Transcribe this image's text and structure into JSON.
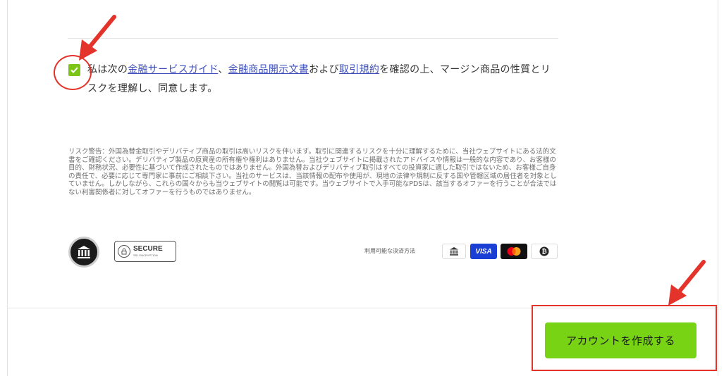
{
  "consent": {
    "checked": true,
    "text_before": "私は次の",
    "link1": "金融サービスガイド",
    "sep1": "、",
    "link2": "金融商品開示文書",
    "between": "および",
    "link3": "取引規約",
    "text_after": "を確認の上、マージン商品の性質とリスクを理解し、同意します。"
  },
  "risk_warning": "リスク警告：外国為替金取引やデリバティブ商品の取引は高いリスクを伴います。取引に関連するリスクを十分に理解するために、当社ウェブサイトにある法的文書をご確認ください。デリバティブ製品の原資産の所有権や権利はありません。当社ウェブサイトに掲載されたアドバイスや情報は一般的な内容であり、お客様の目的、財務状況、必要性に基づいて作成されたものではありません。外国為替およびデリバティブ取引はすべての投資家に適した取引ではないため、お客様ご自身の責任で、必要に応じて専門家に事前にご相談下さい。当社のサービスは、当該情報の配布や使用が、現地の法律や規制に反する国や管轄区域の居住者を対象としていません。しかしながら、これらの国々からも当ウェブサイトの閲覧は可能です。当ウェブサイトで入手可能なPDSは、該当するオファーを行うことが合法ではない利害関係者に対してオファーを行うものではありません。",
  "badges": {
    "secure_label": "SECURE",
    "secure_sub": "SSL ENCRYPTION"
  },
  "payment": {
    "label": "利用可能な決済方法",
    "visa_label": "VISA"
  },
  "cta": {
    "label": "アカウントを作成する"
  },
  "colors": {
    "accent_green": "#77d314",
    "checkbox_green": "#7cc417",
    "annotation_red": "#e4332a",
    "link_blue": "#3c4fb8"
  }
}
